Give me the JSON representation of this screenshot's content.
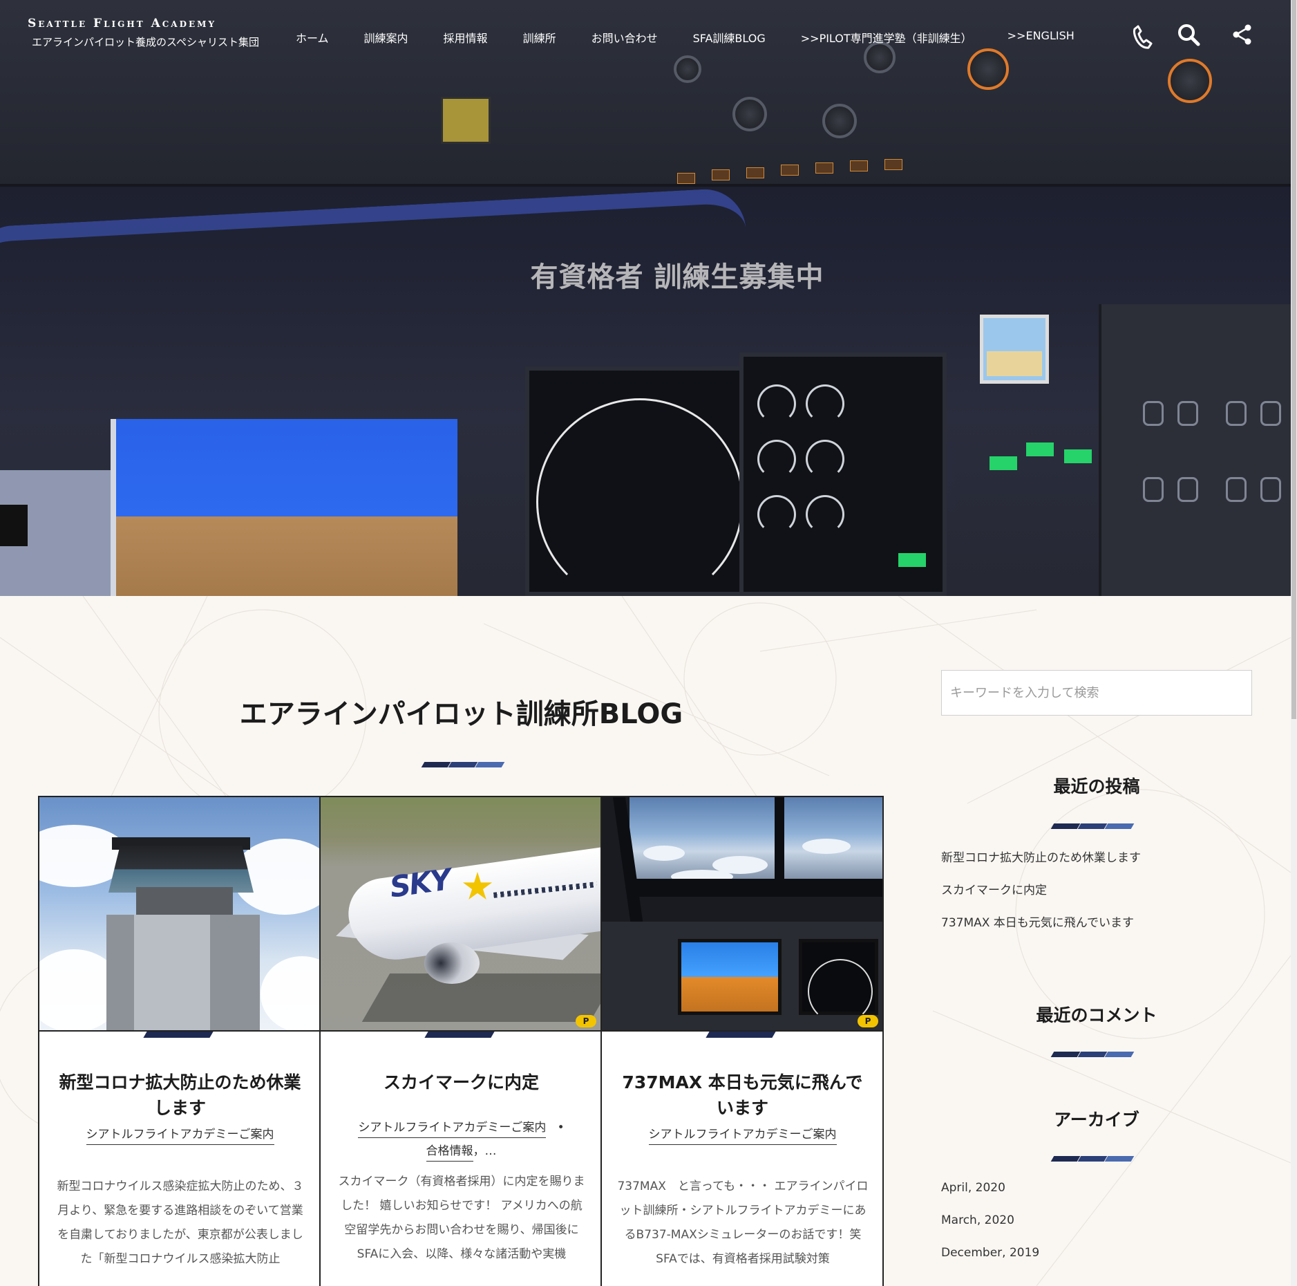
{
  "header": {
    "logo_en": "Seattle Flight Academy",
    "logo_jp": "エアラインパイロット養成のスペシャリスト集団",
    "nav": [
      "ホーム",
      "訓練案内",
      "採用情報",
      "訓練所",
      "お問い合わせ",
      "SFA訓練BLOG",
      ">>PILOT専門進学塾（非訓練生）",
      ">>ENGLISH"
    ],
    "icons": [
      "phone-icon",
      "search-icon",
      "share-icon"
    ]
  },
  "hero": {
    "title": "有資格者 訓練生募集中"
  },
  "main": {
    "title": "エアラインパイロット訓練所BLOG",
    "posts": [
      {
        "title": "新型コロナ拡大防止のため休業します",
        "categories": [
          "シアトルフライトアカデミーご案内"
        ],
        "excerpt": "新型コロナウイルス感染症拡大防止のため、３月より、緊急を要する進路相談をのぞいて営業を自粛しておりましたが、東京都が公表しました「新型コロナウイルス感染拡大防止"
      },
      {
        "title": "スカイマークに内定",
        "categories": [
          "シアトルフライトアカデミーご案内",
          "合格情報"
        ],
        "category_more": "，…",
        "excerpt": "スカイマーク（有資格者採用）に内定を賜りました！ 嬉しいお知らせです！ アメリカへの航空留学先からお問い合わせを賜り、帰国後にSFAに入会、以降、様々な諸活動や実機"
      },
      {
        "title": "737MAX 本日も元気に飛んでいます",
        "categories": [
          "シアトルフライトアカデミーご案内"
        ],
        "excerpt": "737MAX　と言っても・・・ エアラインパイロット訓練所・シアトルフライトアカデミーにあるB737-MAXシミュレーターのお話です！笑 SFAでは、有資格者採用試験対策"
      }
    ],
    "thumb_badge": "P"
  },
  "sidebar": {
    "search_placeholder": "キーワードを入力して検索",
    "recent_posts_title": "最近の投稿",
    "recent_posts": [
      "新型コロナ拡大防止のため休業します",
      "スカイマークに内定",
      "737MAX 本日も元気に飛んでいます"
    ],
    "recent_comments_title": "最近のコメント",
    "archives_title": "アーカイブ",
    "archives": [
      "April, 2020",
      "March, 2020",
      "December, 2019"
    ]
  },
  "colors": {
    "accent_dark": "#1e2a52",
    "accent_mid": "#2b3f78",
    "accent_light": "#4a6bb0",
    "background": "#faf7f3"
  }
}
